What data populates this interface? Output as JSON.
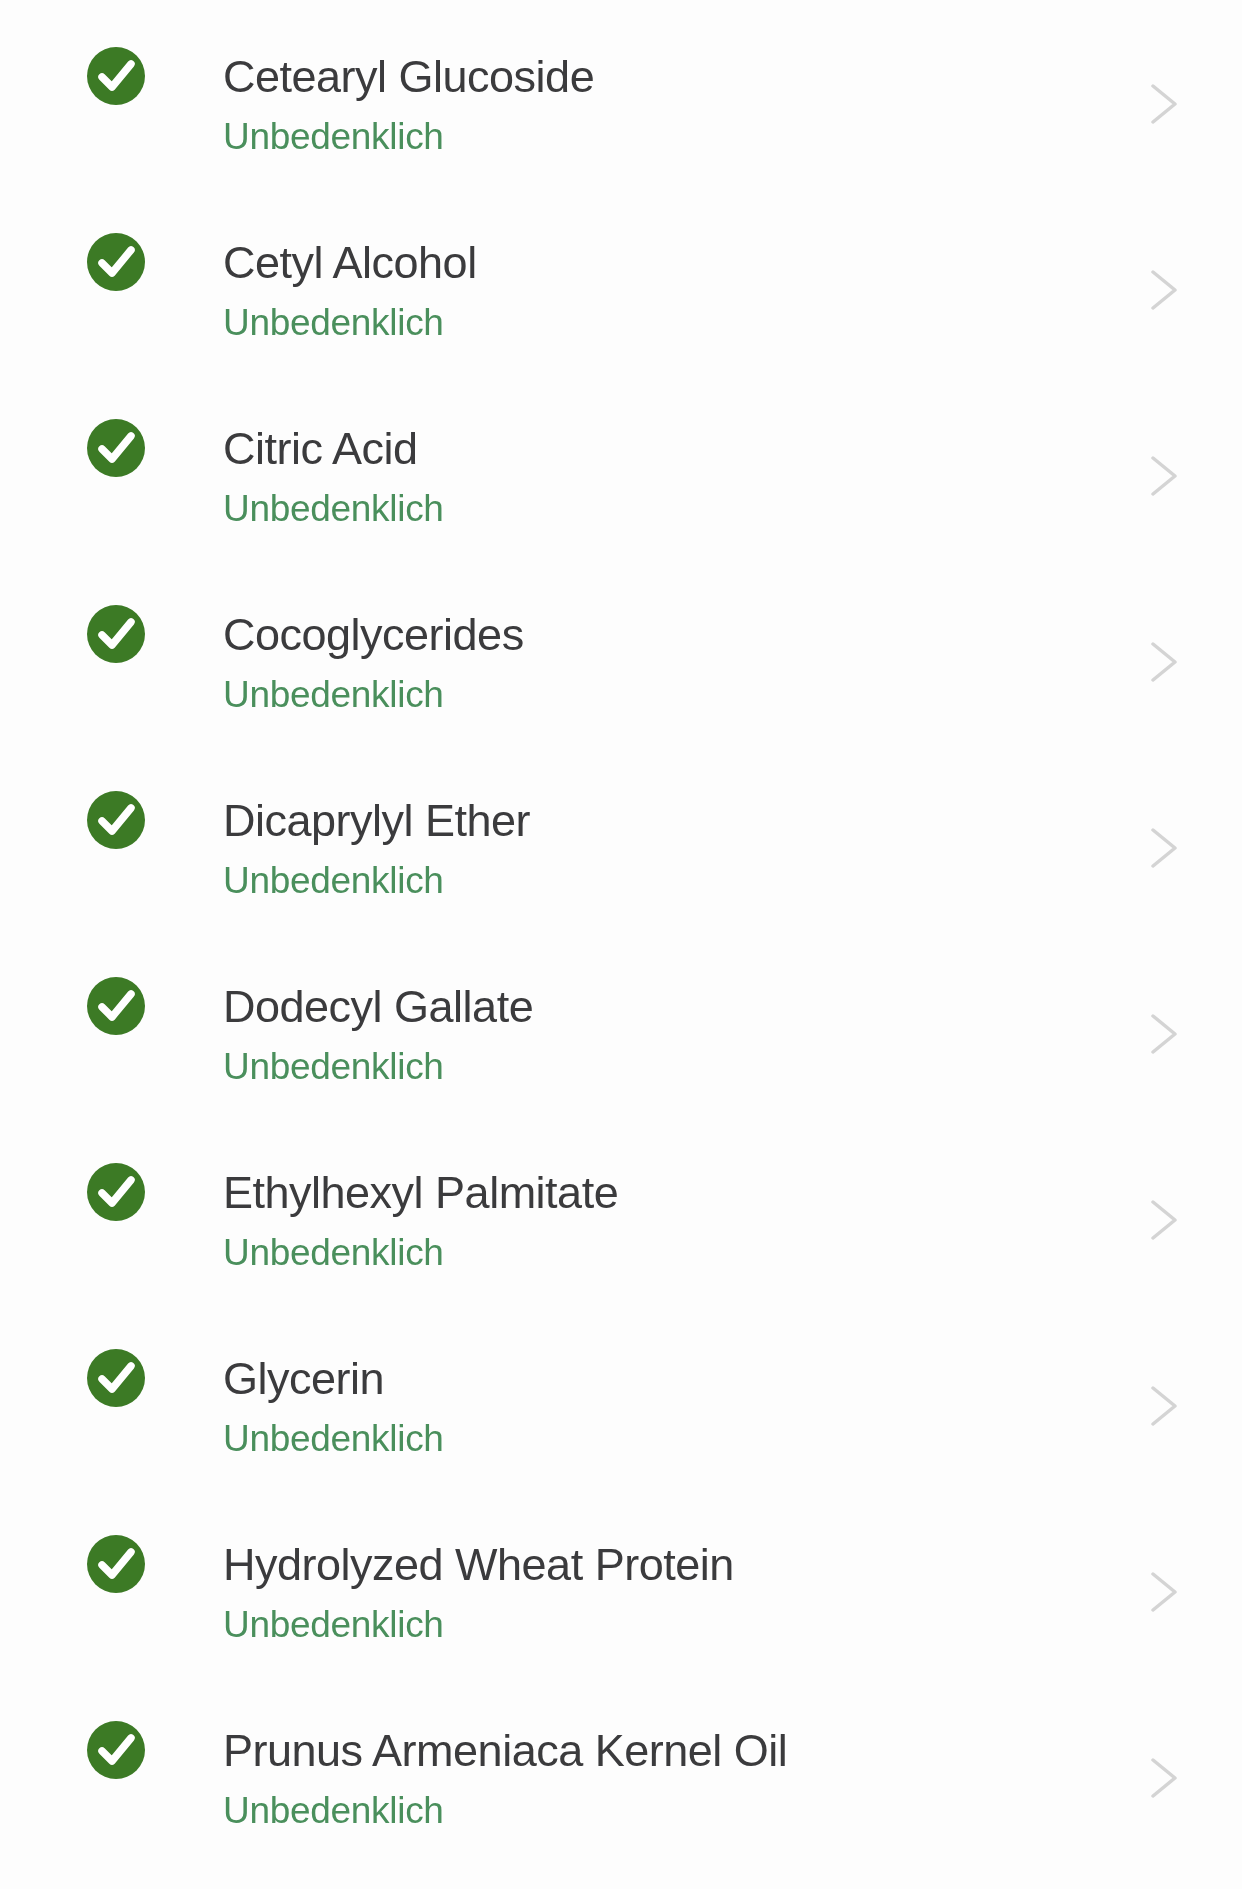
{
  "ingredients": [
    {
      "name": "Cetearyl Glucoside",
      "rating": "Unbedenklich"
    },
    {
      "name": "Cetyl Alcohol",
      "rating": "Unbedenklich"
    },
    {
      "name": "Citric Acid",
      "rating": "Unbedenklich"
    },
    {
      "name": "Cocoglycerides",
      "rating": "Unbedenklich"
    },
    {
      "name": "Dicaprylyl Ether",
      "rating": "Unbedenklich"
    },
    {
      "name": "Dodecyl Gallate",
      "rating": "Unbedenklich"
    },
    {
      "name": "Ethylhexyl Palmitate",
      "rating": "Unbedenklich"
    },
    {
      "name": "Glycerin",
      "rating": "Unbedenklich"
    },
    {
      "name": "Hydrolyzed Wheat Protein",
      "rating": "Unbedenklich"
    },
    {
      "name": "Prunus Armeniaca Kernel Oil",
      "rating": "Unbedenklich"
    }
  ]
}
